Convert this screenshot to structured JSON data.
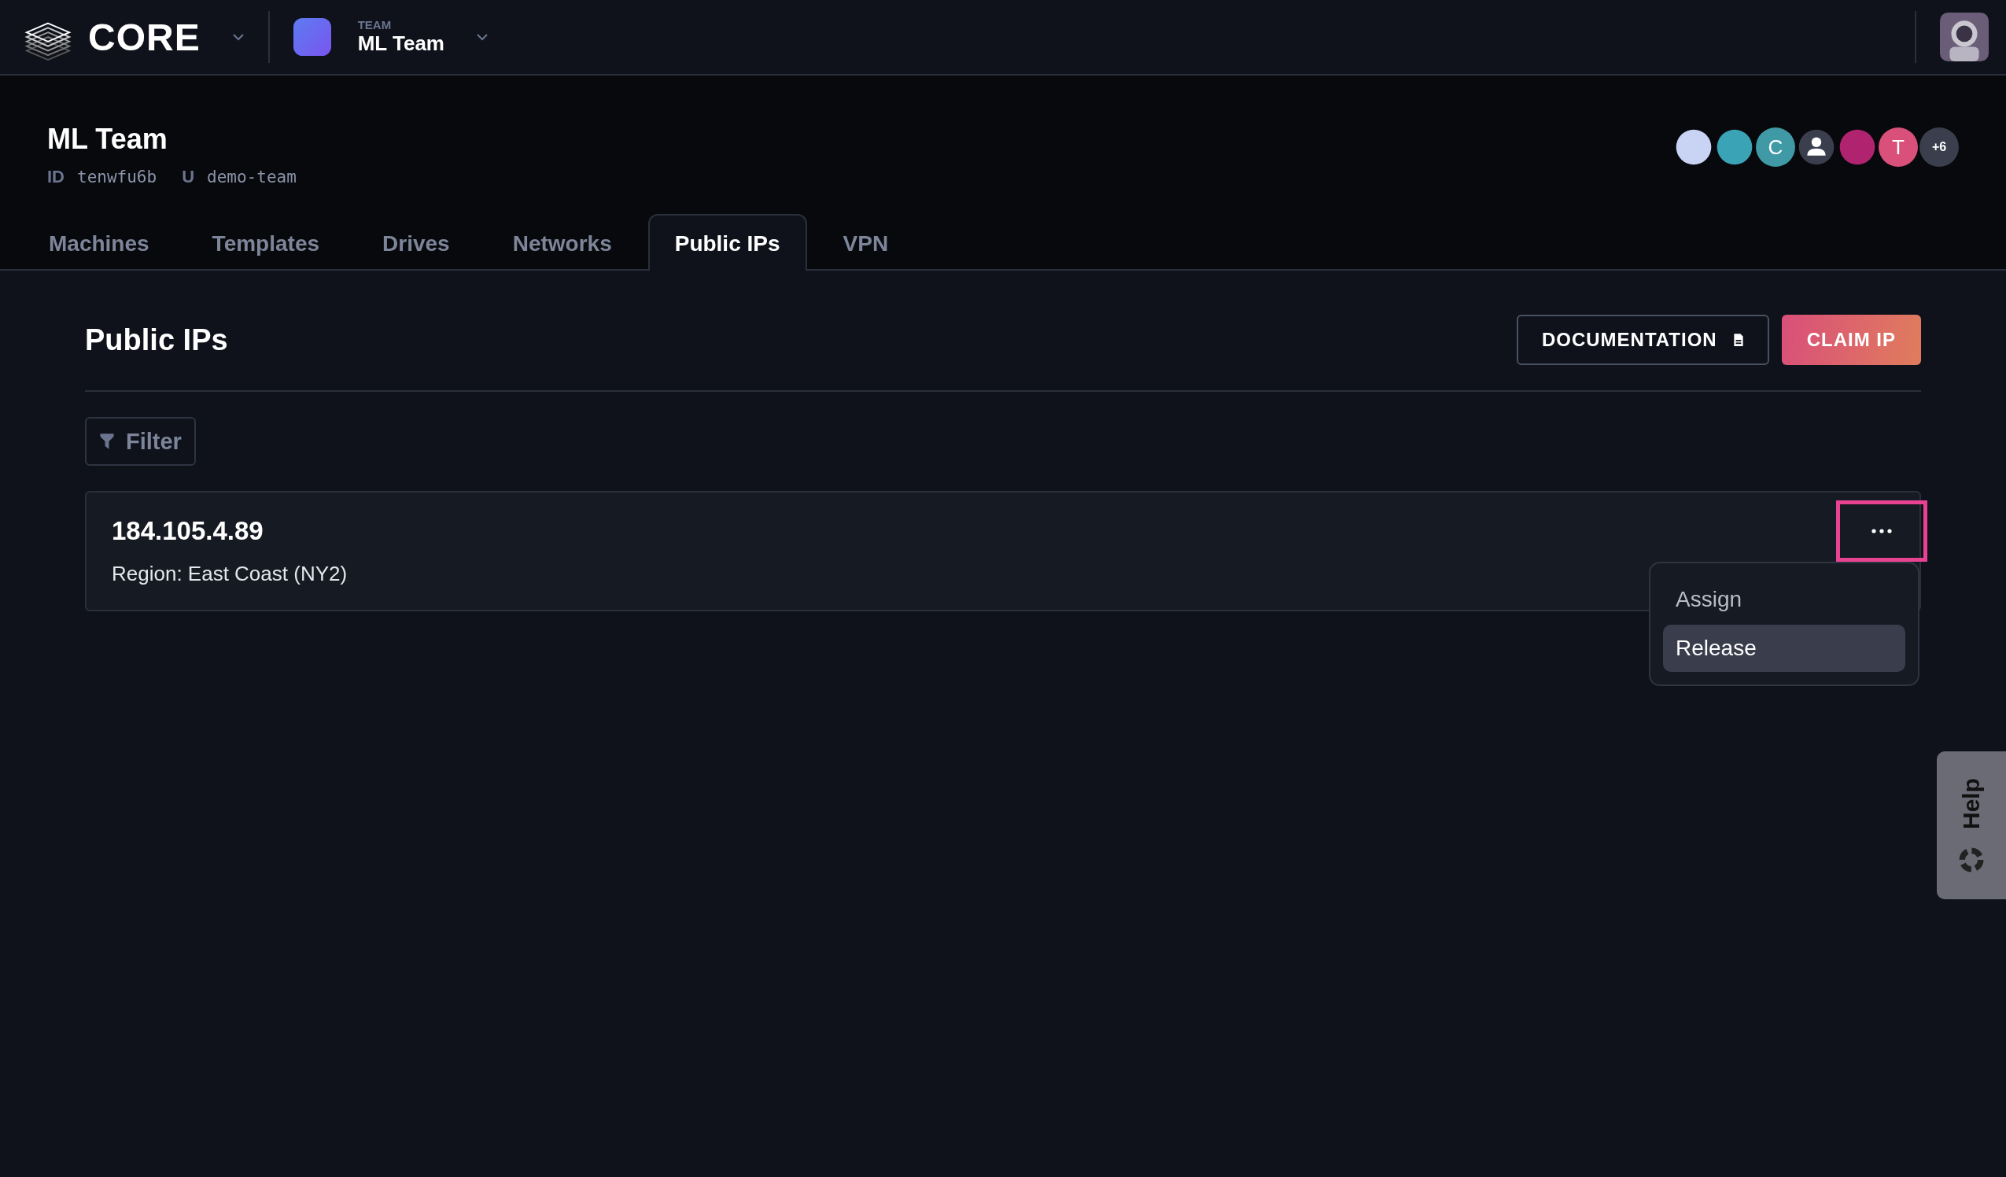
{
  "topbar": {
    "brand": "CORE",
    "team_label": "TEAM",
    "team_name": "ML Team"
  },
  "header": {
    "title": "ML Team",
    "id_label": "ID",
    "id_value": "tenwfu6b",
    "slug_label": "U",
    "slug_value": "demo-team",
    "members": [
      {
        "kind": "photo",
        "color": "#c9d4f5"
      },
      {
        "kind": "photo",
        "color": "#3aa3b5"
      },
      {
        "kind": "letter",
        "text": "C",
        "color": "#3f9aa6"
      },
      {
        "kind": "person",
        "color": "#3b3f4d"
      },
      {
        "kind": "photo",
        "color": "#b0246f"
      },
      {
        "kind": "letter",
        "text": "T",
        "color": "#d9507a"
      },
      {
        "kind": "more",
        "text": "+6",
        "color": "#3b3f4d"
      }
    ]
  },
  "tabs": [
    {
      "label": "Machines",
      "selected": false
    },
    {
      "label": "Templates",
      "selected": false
    },
    {
      "label": "Drives",
      "selected": false
    },
    {
      "label": "Networks",
      "selected": false
    },
    {
      "label": "Public IPs",
      "selected": true
    },
    {
      "label": "VPN",
      "selected": false
    }
  ],
  "page": {
    "title": "Public IPs",
    "buttons": [
      {
        "label": "DOCUMENTATION",
        "kind": "outline"
      },
      {
        "label": "CLAIM IP",
        "kind": "primary"
      }
    ],
    "filter": "Filter"
  },
  "ips": [
    {
      "address": "184.105.4.89",
      "region": "Region: East Coast (NY2)",
      "menu_highlighted": true,
      "menu": [
        {
          "label": "Assign",
          "selected": false
        },
        {
          "label": "Release",
          "selected": true
        }
      ]
    }
  ],
  "help": "Help"
}
